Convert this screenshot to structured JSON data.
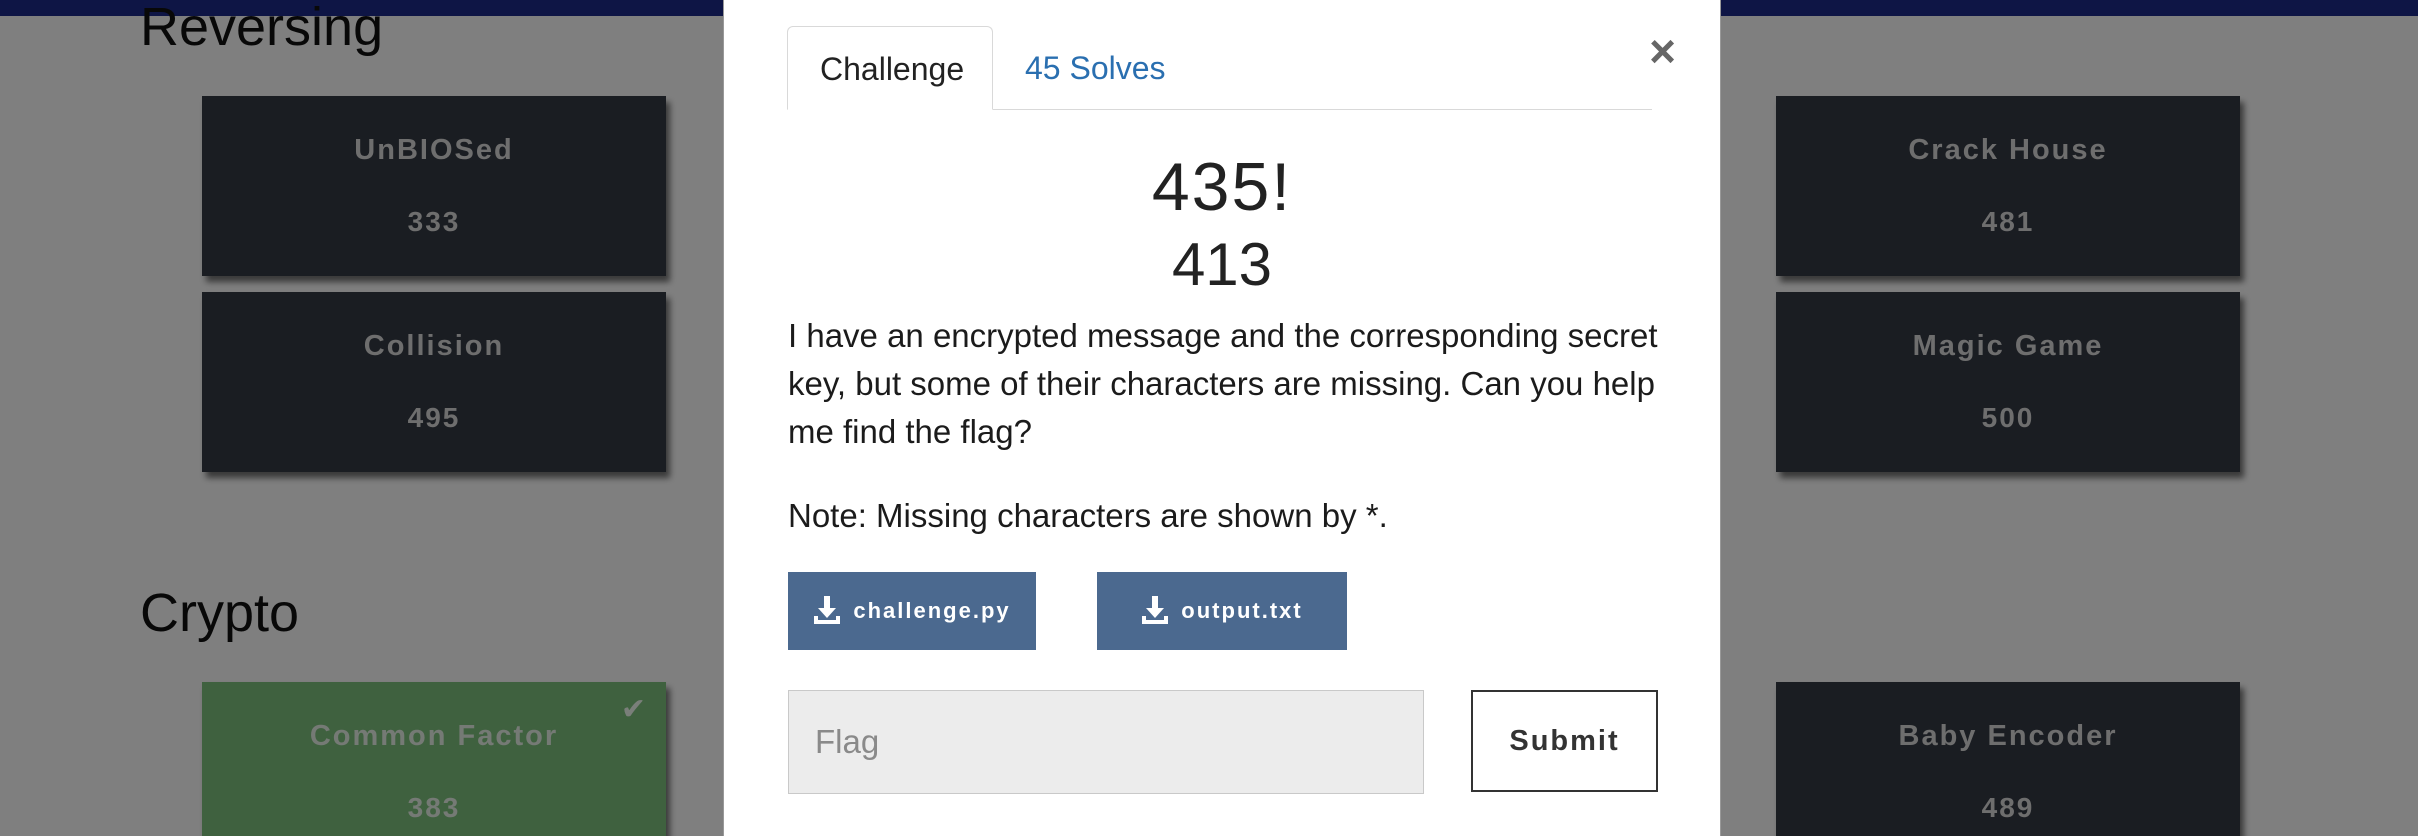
{
  "board": {
    "categories": [
      {
        "title": "Reversing"
      },
      {
        "title": "Crypto"
      }
    ],
    "cards": [
      {
        "name": "UnBIOSed",
        "value": "333",
        "solved": false
      },
      {
        "name": "Crack House",
        "value": "481",
        "solved": false
      },
      {
        "name": "Collision",
        "value": "495",
        "solved": false
      },
      {
        "name": "Magic Game",
        "value": "500",
        "solved": false
      },
      {
        "name": "Common Factor",
        "value": "383",
        "solved": true,
        "icon": "check-icon"
      },
      {
        "name": "Baby Encoder",
        "value": "489",
        "solved": false
      }
    ]
  },
  "modal": {
    "tabs": [
      {
        "label": "Challenge",
        "active": true
      },
      {
        "label": "45 Solves",
        "active": false
      }
    ],
    "close_label": "×",
    "challenge_name": "435!",
    "challenge_value": "413",
    "description": "I have an encrypted message and the corresponding secret key, but some of their characters are missing. Can you help me find the flag?",
    "note": "Note: Missing characters are shown by *.",
    "files": [
      {
        "label": "challenge.py",
        "icon": "download-icon"
      },
      {
        "label": "output.txt",
        "icon": "download-icon"
      }
    ],
    "flag_input": {
      "placeholder": "Flag",
      "value": ""
    },
    "submit_label": "Submit"
  },
  "colors": {
    "navbar": "#1c2a8a",
    "card_bg": "#353a44",
    "card_solved_bg": "#7fc27f",
    "file_button": "#4b698f",
    "tab_link": "#2a6fb0"
  }
}
